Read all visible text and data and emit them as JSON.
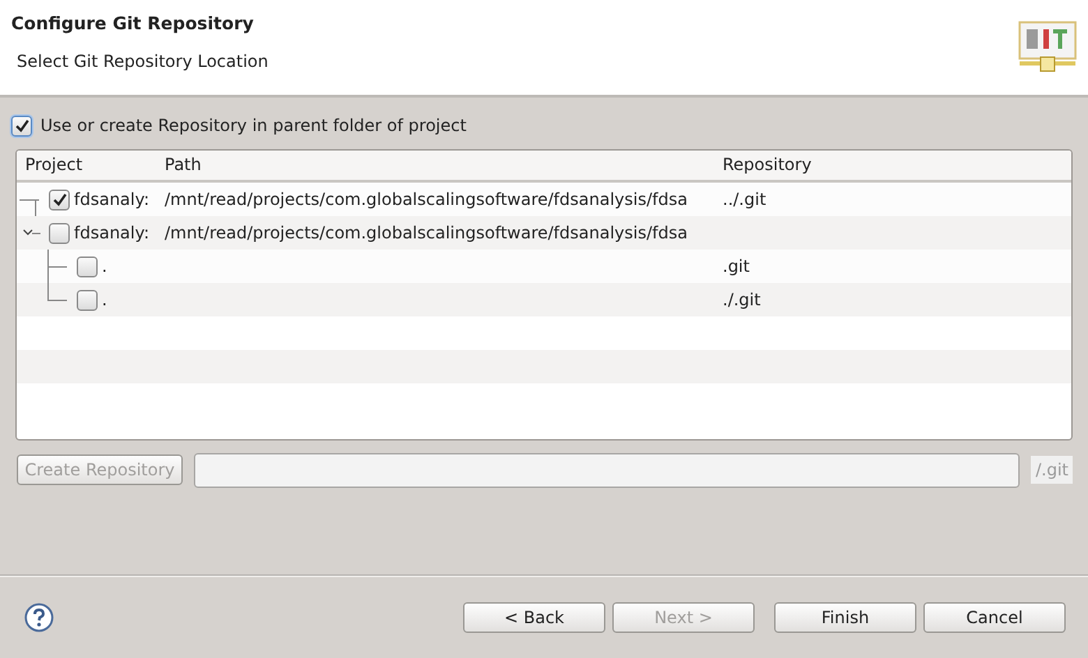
{
  "header": {
    "title": "Configure Git Repository",
    "subtitle": "Select Git Repository Location"
  },
  "parent_folder_option": {
    "label": "Use or create Repository in parent folder of project",
    "checked": true
  },
  "table": {
    "columns": [
      "Project",
      "Path",
      "Repository"
    ],
    "rows": [
      {
        "project": "fdsanaly:",
        "path": "/mnt/read/projects/com.globalscalingsoftware/fdsanalysis/fdsa",
        "repository": "../.git",
        "checked": true
      },
      {
        "project": "fdsanaly:",
        "path": "/mnt/read/projects/com.globalscalingsoftware/fdsanalysis/fdsa",
        "checked": false,
        "expanded": true,
        "children": [
          {
            "project": ".",
            "repository": ".git",
            "checked": false
          },
          {
            "project": ".",
            "repository": "./.git",
            "checked": false
          }
        ]
      }
    ]
  },
  "create_repository": {
    "button": "Create Repository",
    "disabled": true,
    "suffix": "/.git"
  },
  "buttons": [
    {
      "label": "< Back",
      "disabled": false
    },
    {
      "label": "Next >",
      "disabled": true
    },
    {
      "label": "Finish",
      "disabled": false
    },
    {
      "label": "Cancel",
      "disabled": false
    }
  ]
}
